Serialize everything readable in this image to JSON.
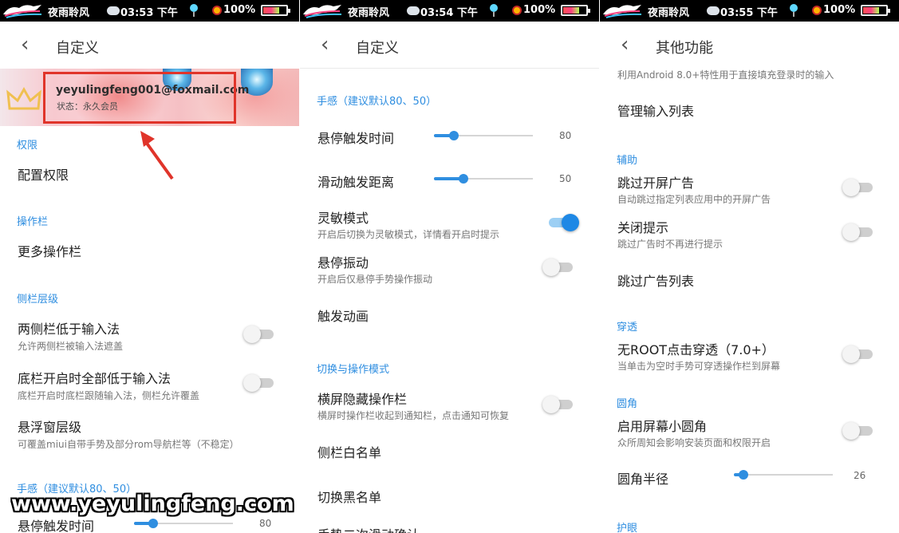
{
  "status_bar": {
    "app_name": "夜雨聆风",
    "times": [
      "03:53 下午",
      "03:54 下午",
      "03:55 下午"
    ],
    "battery": "100%"
  },
  "panel1": {
    "title": "自定义",
    "profile": {
      "email": "yeyulingfeng001@foxmail.com",
      "status": "状态：永久会员"
    },
    "sections": {
      "permissions": "权限",
      "toolbar": "操作栏",
      "layer": "侧栏层级",
      "feel": "手感（建议默认80、50）"
    },
    "items": {
      "config_permissions": "配置权限",
      "more_toolbars": "更多操作栏",
      "sides_below_ime": {
        "title": "两侧栏低于输入法",
        "sub": "允许两侧栏被输入法遮盖",
        "on": false
      },
      "bottom_below_ime": {
        "title": "底栏开启时全部低于输入法",
        "sub": "底栏开启时底栏跟随输入法，侧栏允许覆盖",
        "on": false
      },
      "float_layer": {
        "title": "悬浮窗层级",
        "sub": "可覆盖miui自带手势及部分rom导航栏等（不稳定）"
      },
      "hover_trigger": {
        "title": "悬停触发时间",
        "value": "80"
      }
    }
  },
  "panel2": {
    "title": "自定义",
    "sections": {
      "feel": "手感（建议默认80、50）",
      "switch_mode": "切换与操作模式"
    },
    "items": {
      "hover_trigger": {
        "title": "悬停触发时间",
        "value": "80",
        "fraction": 0.2
      },
      "slide_distance": {
        "title": "滑动触发距离",
        "value": "50",
        "fraction": 0.3
      },
      "sensitive": {
        "title": "灵敏模式",
        "sub": "开启后切换为灵敏模式，详情看开启时提示",
        "on": true
      },
      "hover_vibrate": {
        "title": "悬停振动",
        "sub": "开启后仅悬停手势操作振动",
        "on": false
      },
      "trigger_anim": "触发动画",
      "landscape_hide": {
        "title": "横屏隐藏操作栏",
        "sub": "横屏时操作栏收起到通知栏，点击通知可恢复",
        "on": false
      },
      "whitelist": "侧栏白名单",
      "blacklist": "切换黑名单",
      "second_slide": "手势二次滑动确认"
    }
  },
  "panel3": {
    "title": "其他功能",
    "top_sub": "利用Android 8.0+特性用于直接填充登录时的输入",
    "sections": {
      "assist": "辅助",
      "pierce": "穿透",
      "corner": "圆角",
      "eye": "护眼"
    },
    "items": {
      "manage_input_list": "管理输入列表",
      "skip_splash": {
        "title": "跳过开屏广告",
        "sub": "自动跳过指定列表应用中的开屏广告",
        "on": false
      },
      "close_tip": {
        "title": "关闭提示",
        "sub": "跳过广告时不再进行提示",
        "on": false
      },
      "skip_ad_list": "跳过广告列表",
      "no_root_pierce": {
        "title": "无ROOT点击穿透（7.0+）",
        "sub": "当单击为空时手势可穿透操作栏到屏幕",
        "on": false
      },
      "screen_corner": {
        "title": "启用屏幕小圆角",
        "sub": "众所周知会影响安装页面和权限开启",
        "on": false
      },
      "corner_radius": {
        "title": "圆角半径",
        "value": "26",
        "fraction": 0.1
      }
    }
  },
  "watermark": "www.yeyulingfeng.com",
  "colors": {
    "accent": "#2f8ee0",
    "highlight_box": "#e0342a",
    "status_bar": "#000000"
  }
}
